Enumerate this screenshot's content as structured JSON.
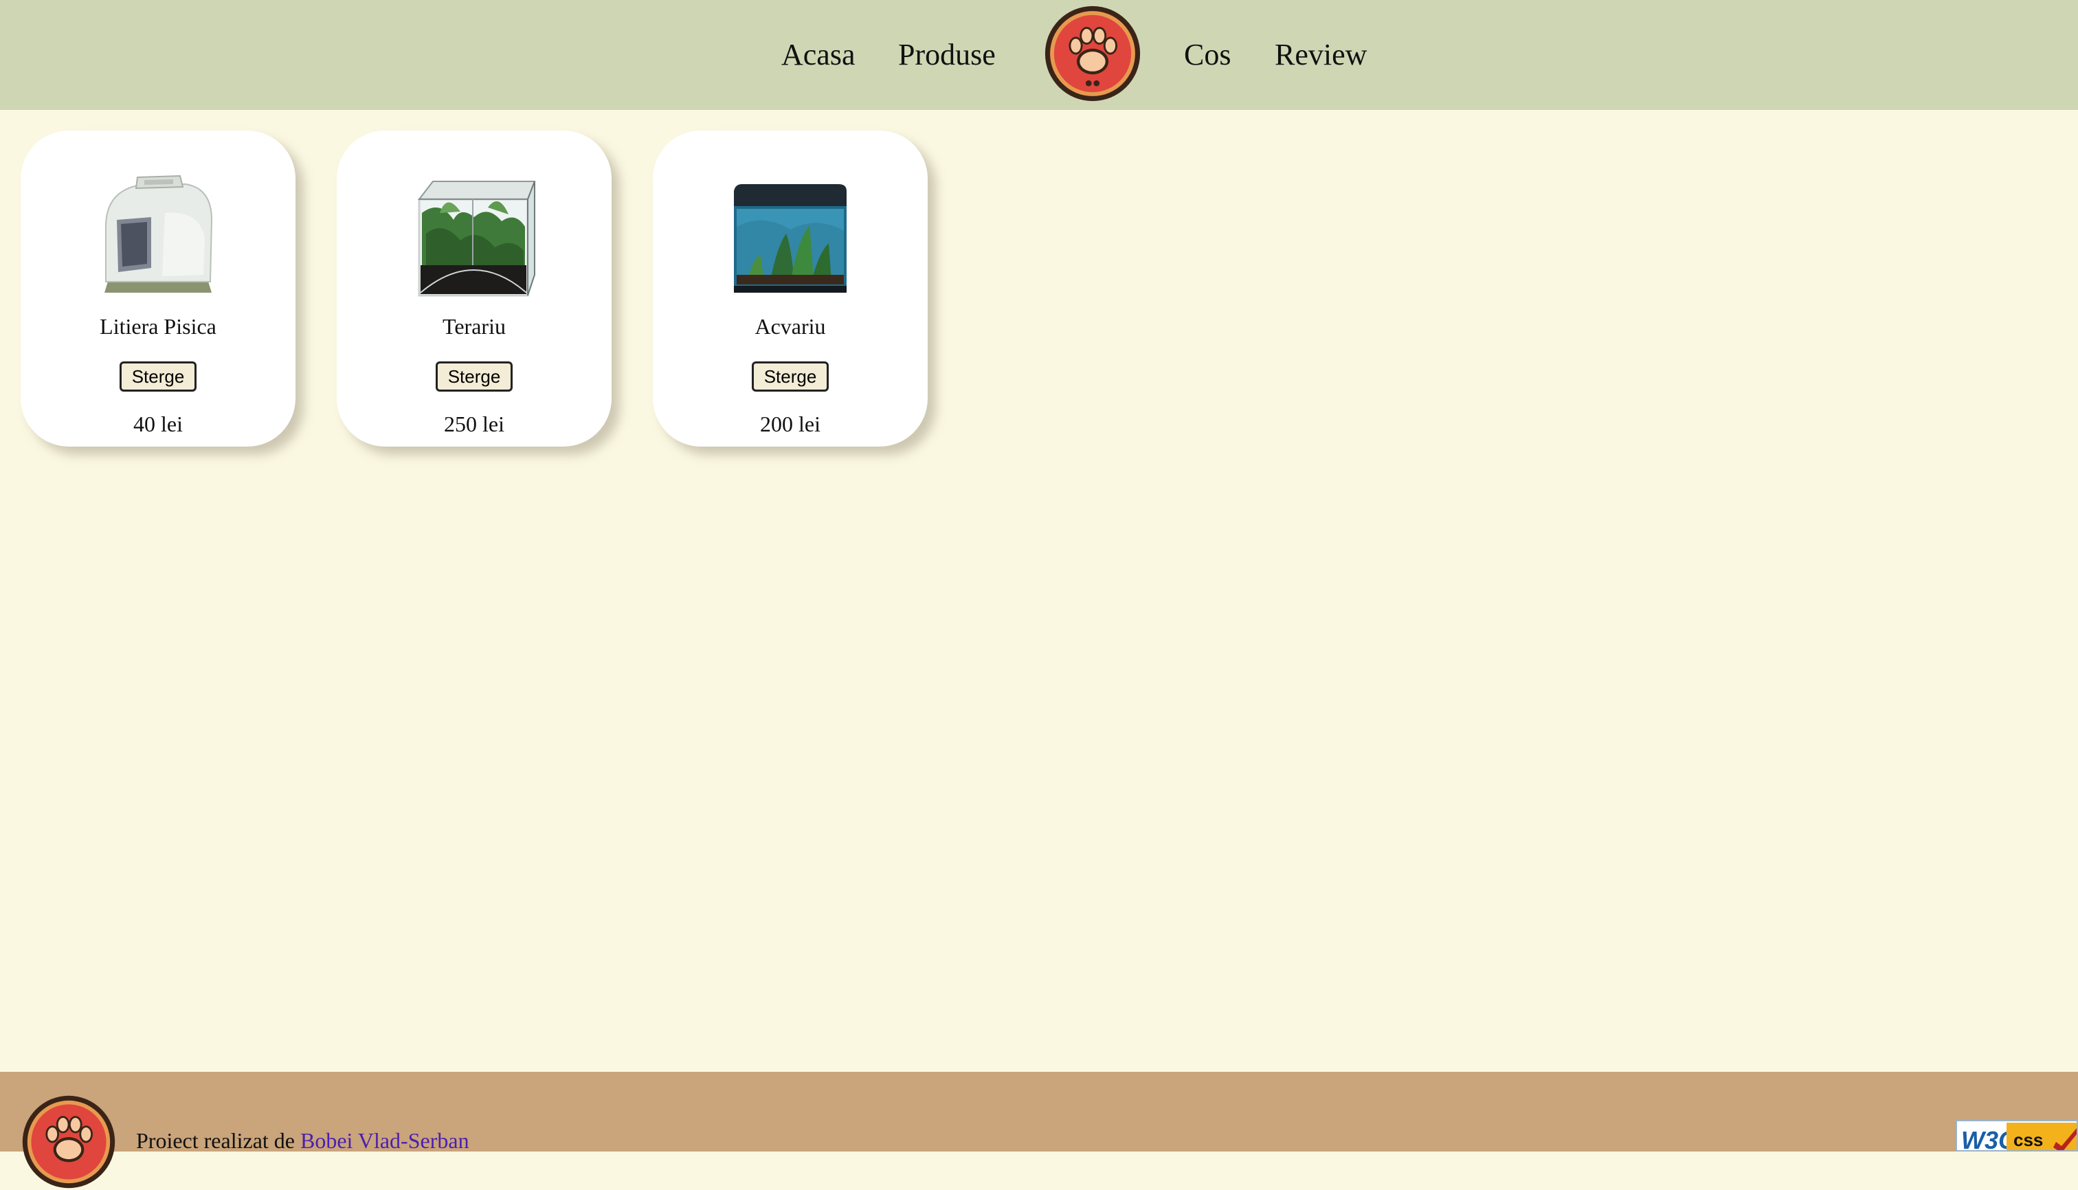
{
  "nav": {
    "items": [
      {
        "label": "Acasa"
      },
      {
        "label": "Produse"
      },
      {
        "label": "Cos"
      },
      {
        "label": "Review"
      }
    ],
    "logo_icon": "paw-print-icon"
  },
  "products": [
    {
      "name": "Litiera Pisica",
      "button": "Sterge",
      "price": "40 lei",
      "image_icon": "cat-litter-box-image"
    },
    {
      "name": "Terariu",
      "button": "Sterge",
      "price": "250 lei",
      "image_icon": "terrarium-image"
    },
    {
      "name": "Acvariu",
      "button": "Sterge",
      "price": "200 lei",
      "image_icon": "aquarium-image"
    }
  ],
  "footer": {
    "prefix": "Proiect realizat de ",
    "author": "Bobei Vlad-Serban",
    "badge": "W3C CSS validator badge"
  },
  "colors": {
    "header_bg": "#cfd6b4",
    "page_bg": "#fbf8e2",
    "footer_bg": "#caa47a",
    "author_link": "#4a1fb0",
    "logo_red": "#e0463d",
    "logo_dark": "#3a2418"
  }
}
